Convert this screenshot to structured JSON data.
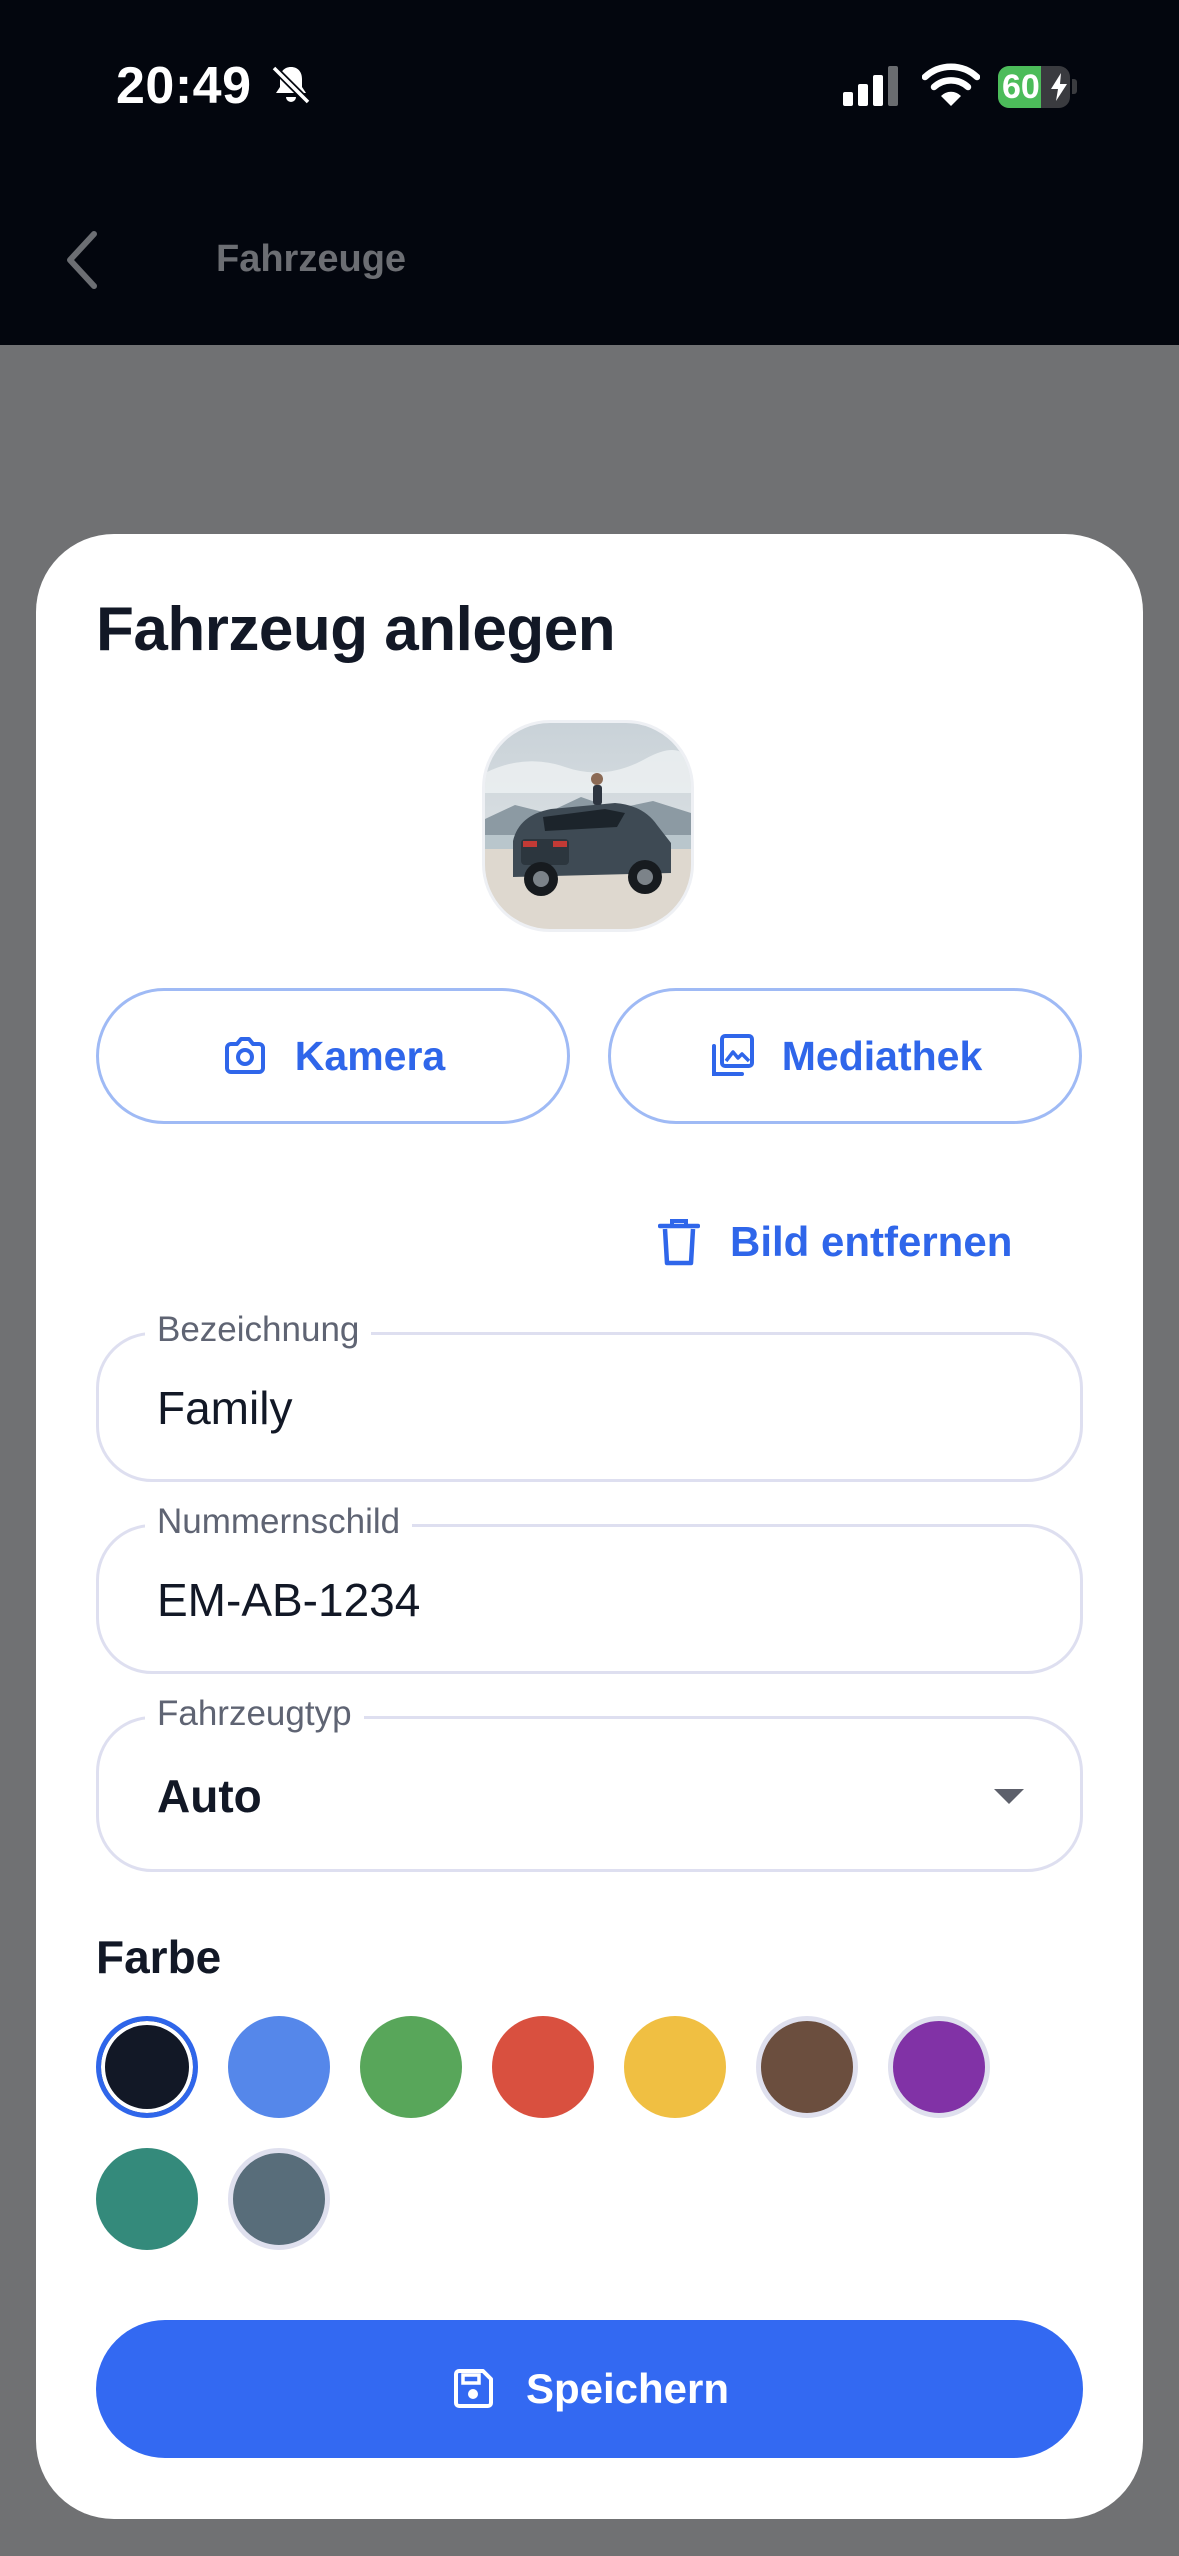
{
  "status_bar": {
    "time": "20:49",
    "battery_text": "60",
    "battery_level": 0.6
  },
  "nav": {
    "back_icon": "chevron-left-icon",
    "title": "Fahrzeuge"
  },
  "sheet": {
    "title": "Fahrzeug anlegen",
    "camera_label": "Kamera",
    "media_label": "Mediathek",
    "remove_label": "Bild entfernen",
    "fields": {
      "name": {
        "label": "Bezeichnung",
        "value": "Family"
      },
      "plate": {
        "label": "Nummernschild",
        "value": "EM-AB-1234"
      },
      "type": {
        "label": "Fahrzeugtyp",
        "value": "Auto"
      }
    },
    "color_title": "Farbe",
    "colors": [
      "#121826",
      "#5587ea",
      "#58a65a",
      "#d9503f",
      "#f0bf42",
      "#6b4e3e",
      "#8132a6",
      "#348a7b",
      "#586d7a"
    ],
    "selected_color_index": 0,
    "save_label": "Speichern"
  },
  "theme": {
    "accent": "#3369f2",
    "accent_outline": "#9fbaf5",
    "text_dark": "#121826"
  }
}
